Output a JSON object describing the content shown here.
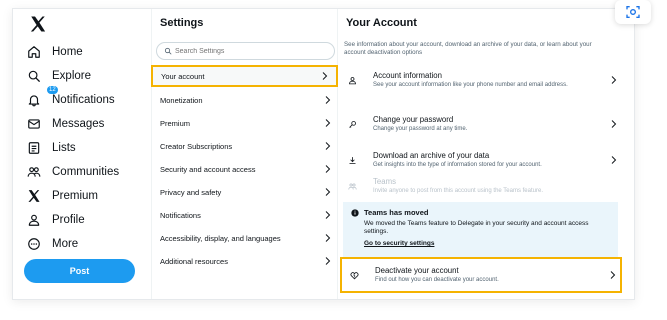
{
  "nav": {
    "items": [
      {
        "label": "Home",
        "icon": "home-icon"
      },
      {
        "label": "Explore",
        "icon": "search-icon"
      },
      {
        "label": "Notifications",
        "icon": "bell-icon",
        "badge": "12"
      },
      {
        "label": "Messages",
        "icon": "mail-icon"
      },
      {
        "label": "Lists",
        "icon": "list-icon"
      },
      {
        "label": "Communities",
        "icon": "communities-icon"
      },
      {
        "label": "Premium",
        "icon": "x-logo-icon"
      },
      {
        "label": "Profile",
        "icon": "person-icon"
      },
      {
        "label": "More",
        "icon": "more-circle-icon"
      }
    ],
    "post_label": "Post"
  },
  "settings": {
    "title": "Settings",
    "search_placeholder": "Search Settings",
    "items": [
      {
        "label": "Your account"
      },
      {
        "label": "Monetization"
      },
      {
        "label": "Premium"
      },
      {
        "label": "Creator Subscriptions"
      },
      {
        "label": "Security and account access"
      },
      {
        "label": "Privacy and safety"
      },
      {
        "label": "Notifications"
      },
      {
        "label": "Accessibility, display, and languages"
      },
      {
        "label": "Additional resources"
      }
    ]
  },
  "account": {
    "title": "Your Account",
    "description": "See information about your account, download an archive of your data, or learn about your account deactivation options",
    "rows": [
      {
        "title": "Account information",
        "subtitle": "See your account information like your phone number and email address."
      },
      {
        "title": "Change your password",
        "subtitle": "Change your password at any time."
      },
      {
        "title": "Download an archive of your data",
        "subtitle": "Get insights into the type of information stored for your account."
      },
      {
        "title": "Teams",
        "subtitle": "Invite anyone to post from this account using the Teams feature."
      }
    ],
    "notice": {
      "title": "Teams has moved",
      "body": "We moved the Teams feature to Delegate in your security and account access settings.",
      "link": "Go to security settings"
    },
    "deactivate": {
      "title": "Deactivate your account",
      "subtitle": "Find out how you can deactivate your account."
    }
  },
  "colors": {
    "accent": "#1d9bf0",
    "highlight": "#f5b301",
    "notice_bg": "#eaf5fb"
  }
}
